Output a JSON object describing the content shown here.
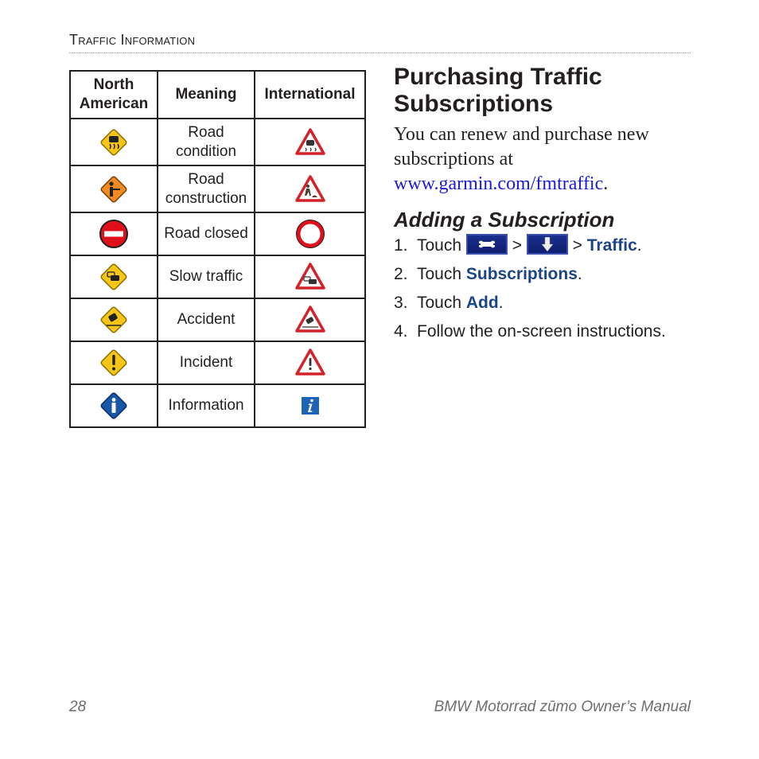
{
  "running_head": "Traffic Information",
  "table": {
    "headers": [
      "North American",
      "Meaning",
      "International"
    ],
    "rows": [
      {
        "na_icon": "road-condition-diamond-icon",
        "meaning": "Road condition",
        "intl_icon": "road-condition-triangle-icon"
      },
      {
        "na_icon": "road-construction-diamond-icon",
        "meaning": "Road construction",
        "intl_icon": "road-construction-triangle-icon"
      },
      {
        "na_icon": "road-closed-circle-icon",
        "meaning": "Road closed",
        "intl_icon": "road-closed-ring-icon"
      },
      {
        "na_icon": "slow-traffic-diamond-icon",
        "meaning": "Slow traffic",
        "intl_icon": "slow-traffic-triangle-icon"
      },
      {
        "na_icon": "accident-diamond-icon",
        "meaning": "Accident",
        "intl_icon": "accident-triangle-icon"
      },
      {
        "na_icon": "incident-diamond-icon",
        "meaning": "Incident",
        "intl_icon": "incident-triangle-icon"
      },
      {
        "na_icon": "information-diamond-icon",
        "meaning": "Information",
        "intl_icon": "information-square-icon"
      }
    ]
  },
  "section": {
    "title": "Purchasing Traffic Subscriptions",
    "body_prefix": "You can renew and purchase new subscriptions at ",
    "link": "www.garmin.com/fmtraffic",
    "body_suffix": "."
  },
  "subsection": {
    "title": "Adding a Subscription",
    "steps": [
      {
        "num": "1.",
        "prefix": "Touch ",
        "buttons": [
          "wrench-icon",
          "down-arrow-icon"
        ],
        "sep": " > ",
        "term": "Traffic",
        "suffix": "."
      },
      {
        "num": "2.",
        "prefix": "Touch ",
        "term": "Subscriptions",
        "suffix": "."
      },
      {
        "num": "3.",
        "prefix": "Touch ",
        "term": "Add",
        "suffix": "."
      },
      {
        "num": "4.",
        "text": "Follow the on-screen instructions."
      }
    ]
  },
  "colors": {
    "link": "#1a1adf",
    "ui_term": "#1c4587",
    "button_bg": "#152680",
    "footer": "#6d6e71"
  },
  "footer": {
    "page_number": "28",
    "manual_title": "BMW Motorrad zūmo Owner’s Manual"
  }
}
